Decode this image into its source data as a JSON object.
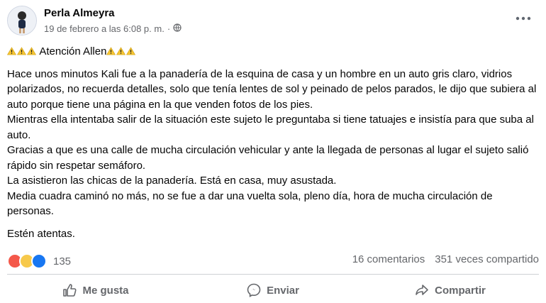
{
  "post": {
    "author": "Perla Almeyra",
    "timestamp": "19 de febrero a las 6:08 p. m.",
    "separator": "·",
    "privacy_icon": "globe-icon",
    "more_icon": "more-options-icon",
    "title": "Atención Allen",
    "paragraph": "Hace unos minutos Kali fue a la panadería de la esquina de casa y un hombre en un auto gris claro, vidrios polarizados, no recuerda detalles, solo que tenía lentes de sol y peinado de pelos parados, le dijo que subiera al auto porque tiene una página en la que venden fotos de los pies.\nMientras ella intentaba salir de la situación este sujeto le preguntaba si tiene tatuajes e insistía para que suba al auto.\nGracias a que es una calle de mucha circulación vehicular y ante la llegada de personas al lugar el sujeto salió rápido sin respetar semáforo.\nLa asistieron las chicas de la panadería. Está en casa, muy asustada.\nMedia cuadra caminó no más, no se fue a dar una vuelta sola, pleno día, hora de mucha circulación de personas.",
    "closing": "Estén atentas."
  },
  "stats": {
    "reaction_count": "135",
    "comments": "16 comentarios",
    "shares": "351 veces compartido"
  },
  "actions": {
    "like": "Me gusta",
    "send": "Enviar",
    "share": "Compartir"
  },
  "colors": {
    "text": "#050505",
    "secondary": "#65676b",
    "like_blue": "#1877f2",
    "divider": "#ced0d4"
  }
}
